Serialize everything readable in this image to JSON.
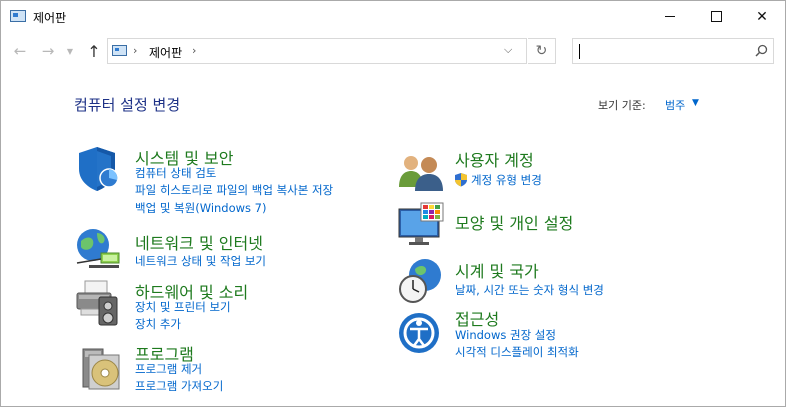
{
  "window": {
    "title": "제어판",
    "controls": [
      "minimize",
      "maximize",
      "close"
    ]
  },
  "address_bar": {
    "crumb": "제어판",
    "separator": "›"
  },
  "search": {
    "placeholder": "",
    "value": ""
  },
  "header": {
    "title": "컴퓨터 설정 변경",
    "view_by_label": "보기 기준:",
    "view_by_value": "범주"
  },
  "categories": [
    {
      "title": "시스템 및 보안",
      "icon": "shield-icon",
      "links": [
        "컴퓨터 상태 검토",
        "파일 히스토리로 파일의 백업 복사본 저장",
        "백업 및 복원(Windows 7)"
      ]
    },
    {
      "title": "네트워크 및 인터넷",
      "icon": "network-globe-icon",
      "links": [
        "네트워크 상태 및 작업 보기"
      ]
    },
    {
      "title": "하드웨어 및 소리",
      "icon": "printer-speaker-icon",
      "links": [
        "장치 및 프린터 보기",
        "장치 추가"
      ]
    },
    {
      "title": "프로그램",
      "icon": "program-disc-icon",
      "links": [
        "프로그램 제거",
        "프로그램 가져오기"
      ]
    },
    {
      "title": "사용자 계정",
      "icon": "users-icon",
      "links": [
        "계정 유형 변경"
      ]
    },
    {
      "title": "모양 및 개인 설정",
      "icon": "monitor-color-icon",
      "links": []
    },
    {
      "title": "시계 및 국가",
      "icon": "clock-globe-icon",
      "links": [
        "날짜, 시간 또는 숫자 형식 변경"
      ]
    },
    {
      "title": "접근성",
      "icon": "accessibility-icon",
      "links": [
        "Windows 권장 설정",
        "시각적 디스플레이 최적화"
      ]
    }
  ],
  "colors": {
    "category_title": "#1e7a1e",
    "link": "#0066cc",
    "heading": "#1e3287"
  }
}
